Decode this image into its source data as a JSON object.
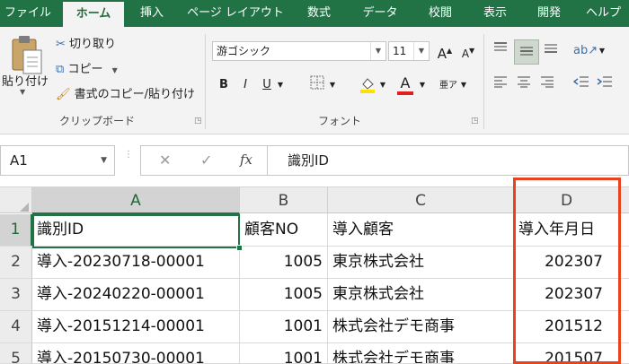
{
  "ribbon_tabs": [
    "ファイル",
    "ホーム",
    "挿入",
    "ページ レイアウト",
    "数式",
    "データ",
    "校閲",
    "表示",
    "開発",
    "ヘルプ"
  ],
  "clipboard": {
    "paste_label": "貼り付け",
    "cut_label": "切り取り",
    "copy_label": "コピー",
    "format_painter_label": "書式のコピー/貼り付け",
    "group_label": "クリップボード"
  },
  "font": {
    "name": "游ゴシック",
    "size": "11",
    "grow": "A",
    "shrink": "A",
    "bold": "B",
    "italic": "I",
    "underline": "U",
    "color_letter": "A",
    "group_label": "フォント"
  },
  "formula_bar": {
    "name_box": "A1",
    "fx": "fx",
    "cancel": "✕",
    "enter": "✓",
    "content": "識別ID"
  },
  "columns": [
    "A",
    "B",
    "C",
    "D"
  ],
  "rows": [
    {
      "num": "1",
      "a": "識別ID",
      "b": "顧客NO",
      "c": "導入顧客",
      "d": "導入年月日"
    },
    {
      "num": "2",
      "a": "導入-20230718-00001",
      "b": "1005",
      "c": "東京株式会社",
      "d": "202307"
    },
    {
      "num": "3",
      "a": "導入-20240220-00001",
      "b": "1005",
      "c": "東京株式会社",
      "d": "202307"
    },
    {
      "num": "4",
      "a": "導入-20151214-00001",
      "b": "1001",
      "c": "株式会社デモ商事",
      "d": "201512"
    },
    {
      "num": "5",
      "a": "導入-20150730-00001",
      "b": "1001",
      "c": "株式会社デモ商事",
      "d": "201507"
    }
  ],
  "colors": {
    "ribbon_green": "#217346",
    "highlight_red": "#e8421e",
    "fill_yellow": "#ffe100",
    "font_red": "#e02020"
  }
}
